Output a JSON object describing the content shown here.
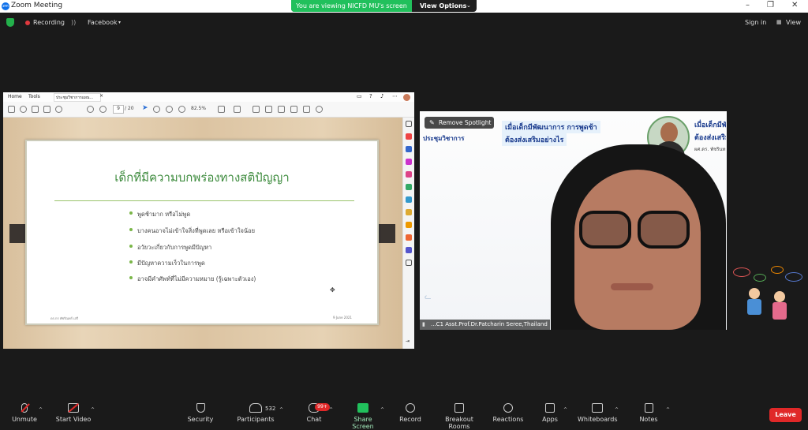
{
  "window": {
    "title": "Zoom Meeting"
  },
  "share_bar": {
    "viewing_label": "You are viewing NICFD MU's screen",
    "view_options": "View Options"
  },
  "top": {
    "recording": "Recording",
    "facebook": "Facebook",
    "sign_in": "Sign in",
    "view": "View"
  },
  "pdf": {
    "tabs": [
      "Home",
      "Tools",
      "ประชุมวิชาการแผน..."
    ],
    "page_current": "9",
    "page_total": "/ 20",
    "zoom": "82.5%",
    "slide": {
      "title": "เด็กที่มีความบกพร่องทางสติปัญญา",
      "bullets": [
        "พูดช้ามาก หรือไม่พูด",
        "บางคนอาจไม่เข้าใจสิ่งที่พูดเลย หรือเข้าใจน้อย",
        "อวัยวะเกี่ยวกับการพูดมีปัญหา",
        "มีปัญหาความเร็วในการพูด",
        "อาจมีคำศัพท์ที่ไม่มีความหมาย (รู้เฉพาะตัวเอง)"
      ],
      "footer_left": "ดร.กร พัชริณทร์ เสรี",
      "footer_right": "9 June 2021"
    }
  },
  "video": {
    "remove_spotlight": "Remove Spotlight",
    "participant_name": "...C1 Asst.Prof.Dr.Patcharin Seree,Thailand",
    "background": {
      "header_left": "ประชุมวิชาการ",
      "title_line1": "เมื่อเด็กมีพัฒนาการ การพูดช้า",
      "title_line2": "ต้องส่งเสริมอย่างไร",
      "presenter": "ผศ.ดร. พัชรินทร์ เสรี"
    }
  },
  "toolbar": {
    "unmute": "Unmute",
    "start_video": "Start Video",
    "security": "Security",
    "participants": "Participants",
    "participants_count": "532",
    "chat": "Chat",
    "chat_badge": "99+",
    "share_screen": "Share Screen",
    "record": "Record",
    "breakout": "Breakout Rooms",
    "reactions": "Reactions",
    "apps": "Apps",
    "whiteboards": "Whiteboards",
    "notes": "Notes",
    "leave": "Leave"
  },
  "colors": {
    "share_green": "#21c05c",
    "leave_red": "#e02828",
    "slide_title_green": "#3d8b3d",
    "zoom_blue": "#0e71eb"
  }
}
